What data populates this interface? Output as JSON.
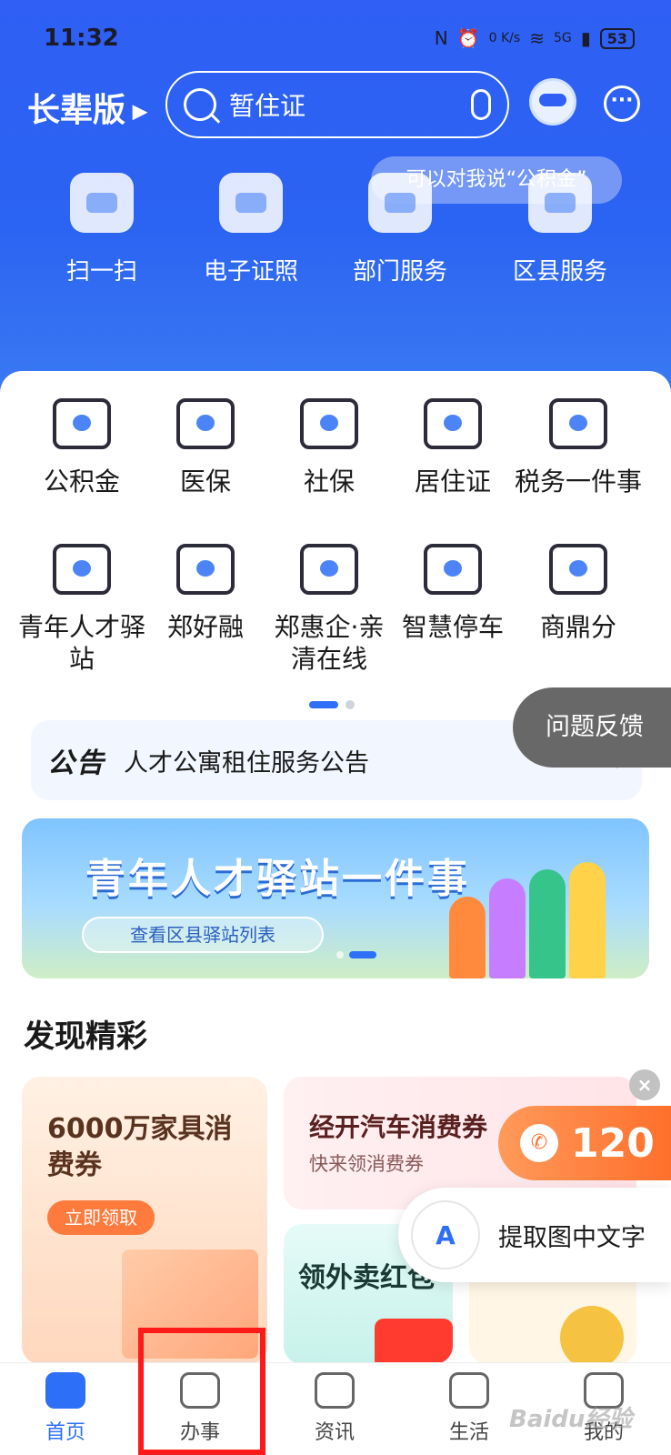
{
  "status_bar": {
    "time": "11:32",
    "network_speed": "0 K/s",
    "signal": "5G",
    "battery": "53"
  },
  "header": {
    "elder_mode_label": "长辈版",
    "search_placeholder": "暂住证",
    "assistant_hint": "可以对我说“公积金”"
  },
  "quick_actions": [
    {
      "label": "扫一扫",
      "icon": "scan-icon"
    },
    {
      "label": "电子证照",
      "icon": "id-card-icon"
    },
    {
      "label": "部门服务",
      "icon": "department-icon"
    },
    {
      "label": "区县服务",
      "icon": "district-icon"
    }
  ],
  "services": [
    {
      "label": "公积金",
      "icon": "housing-fund-icon"
    },
    {
      "label": "医保",
      "icon": "medical-insurance-icon"
    },
    {
      "label": "社保",
      "icon": "social-security-icon"
    },
    {
      "label": "居住证",
      "icon": "residence-permit-icon"
    },
    {
      "label": "税务一件事",
      "icon": "tax-icon"
    },
    {
      "label": "青年人才驿站",
      "icon": "youth-talent-icon"
    },
    {
      "label": "郑好融",
      "icon": "finance-icon"
    },
    {
      "label": "郑惠企·亲清在线",
      "icon": "enterprise-icon"
    },
    {
      "label": "智慧停车",
      "icon": "parking-icon"
    },
    {
      "label": "商鼎分",
      "icon": "credit-score-icon"
    }
  ],
  "notice": {
    "tag": "公告",
    "text": "人才公寓租住服务公告"
  },
  "feedback_label": "问题反馈",
  "banner": {
    "title": "青年人才驿站一件事",
    "button": "查看区县驿站列表"
  },
  "discover": {
    "title": "发现精彩",
    "cards": [
      {
        "title": "6000万家具消费券",
        "button": "立即领取"
      },
      {
        "title": "经开汽车消费券",
        "subtitle": "快来领消费券"
      },
      {
        "title": "领外卖红包"
      }
    ]
  },
  "hotline": {
    "number": "120"
  },
  "ocr_label": "提取图中文字",
  "tabs": [
    {
      "label": "首页",
      "active": true
    },
    {
      "label": "办事",
      "active": false
    },
    {
      "label": "资讯",
      "active": false
    },
    {
      "label": "生活",
      "active": false
    },
    {
      "label": "我的",
      "active": false
    }
  ],
  "watermark": "Baidu经验",
  "colors": {
    "primary": "#2d6ff7",
    "highlight": "#ff1a1a",
    "hotline": "#ff6f2c"
  }
}
